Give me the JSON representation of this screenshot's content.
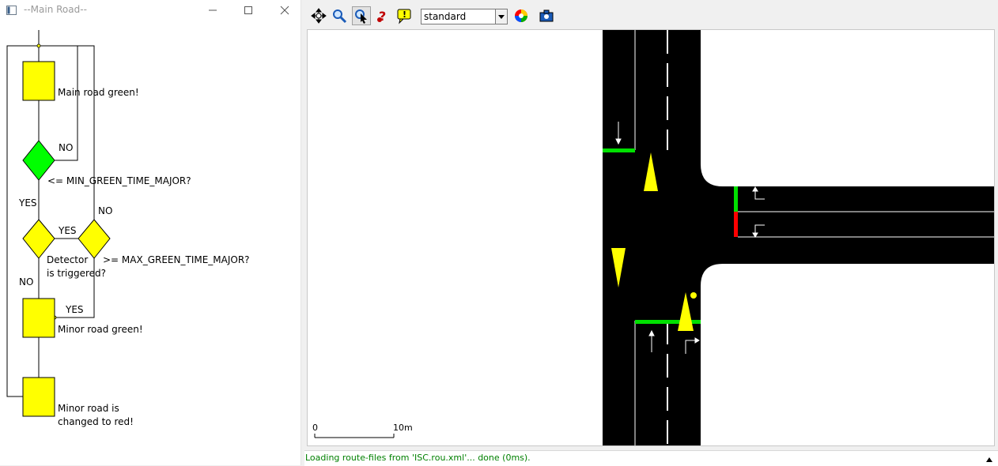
{
  "flow_window": {
    "title": "--Main Road--",
    "controls": [
      "minimize",
      "maximize",
      "close"
    ],
    "nodes": {
      "main_green": "Main road green!",
      "min_green_check": "<= MIN_GREEN_TIME_MAJOR?",
      "detector_line1": "Detector",
      "detector_line2": "is triggered?",
      "max_green_check": ">= MAX_GREEN_TIME_MAJOR?",
      "minor_green": "Minor road green!",
      "minor_red_line1": "Minor road is",
      "minor_red_line2": "changed to red!"
    },
    "edge_labels": {
      "no_loop": "NO",
      "yes_left": "YES",
      "no_max": "NO",
      "yes_mid": "YES",
      "no_detector": "NO",
      "yes_max": "YES"
    },
    "colors": {
      "process": "#ffff00",
      "active_decision": "#00ff00",
      "decision": "#ffff00"
    }
  },
  "sim_view": {
    "toolbar": {
      "buttons": [
        "recenter-view-icon",
        "locate-icon",
        "edit-viewport-icon",
        "breakpoints-icon",
        "view-settings-icon"
      ],
      "scheme_value": "standard",
      "color_wheel": "color-scheme-icon",
      "screenshot": "screenshot-icon"
    },
    "scale_bar": {
      "start": "0",
      "end": "10m"
    },
    "signal_colors": {
      "green": "#00e000",
      "red": "#ff0000"
    },
    "status_text": "Loading route-files from 'ISC.rou.xml'... done (0ms)."
  }
}
